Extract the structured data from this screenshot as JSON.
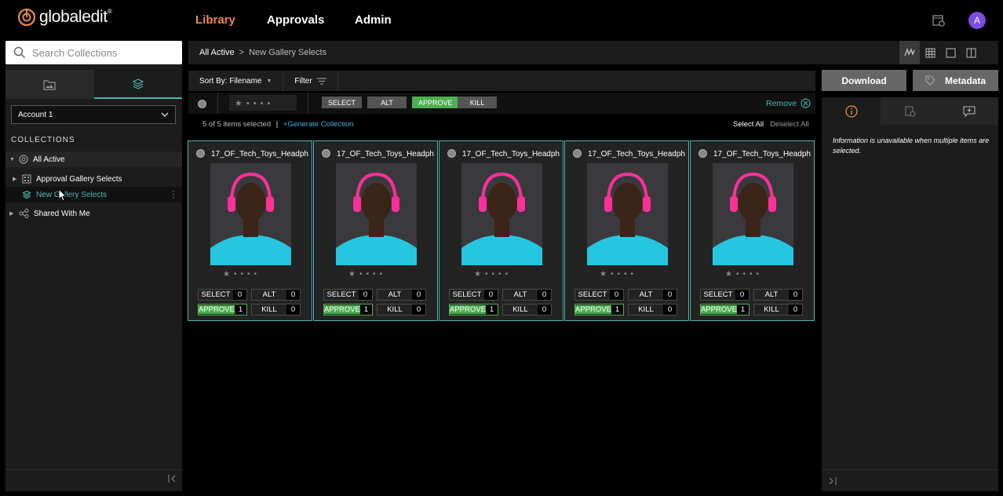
{
  "app": {
    "brand": "globaledit",
    "brand_mark": "®"
  },
  "nav": {
    "library": "Library",
    "approvals": "Approvals",
    "admin": "Admin",
    "avatar": "A"
  },
  "search": {
    "placeholder": "Search Collections"
  },
  "account": {
    "value": "Account 1"
  },
  "collections": {
    "heading": "COLLECTIONS",
    "all_active": "All Active",
    "approval_gallery": "Approval Gallery Selects",
    "new_gallery": "New Gallery Selects",
    "shared": "Shared With Me"
  },
  "breadcrumb": {
    "root": "All Active",
    "sep": ">",
    "current": "New Gallery Selects"
  },
  "toolbar": {
    "sort": "Sort By: Filename",
    "filter": "Filter"
  },
  "filters": {
    "select": "SELECT",
    "alt": "ALT",
    "approve": "APPROVE",
    "kill": "KILL",
    "remove": "Remove"
  },
  "selection": {
    "count": "5 of 5 items selected",
    "divider": "|",
    "generate": "+Generate Collection",
    "select_all": "Select All",
    "deselect_all": "Deselect All"
  },
  "cards": [
    {
      "filename": "17_OF_Tech_Toys_Headph...",
      "select": "0",
      "alt": "0",
      "approve": "1",
      "kill": "0"
    },
    {
      "filename": "17_OF_Tech_Toys_Headph...",
      "select": "0",
      "alt": "0",
      "approve": "1",
      "kill": "0"
    },
    {
      "filename": "17_OF_Tech_Toys_Headph...",
      "select": "0",
      "alt": "0",
      "approve": "1",
      "kill": "0"
    },
    {
      "filename": "17_OF_Tech_Toys_Headph...",
      "select": "0",
      "alt": "0",
      "approve": "1",
      "kill": "0"
    },
    {
      "filename": "17_OF_Tech_Toys_Headph...",
      "select": "0",
      "alt": "0",
      "approve": "1",
      "kill": "0"
    }
  ],
  "card_labels": {
    "select": "SELECT",
    "alt": "ALT",
    "approve": "APPROVE",
    "kill": "KILL"
  },
  "right": {
    "download": "Download",
    "metadata": "Metadata",
    "info": "Information is unavailable when multiple items are selected."
  },
  "colors": {
    "accent": "#4db6ac",
    "approve": "#4caf50",
    "nav_active": "#e98a4a",
    "avatar": "#7b4de0"
  }
}
